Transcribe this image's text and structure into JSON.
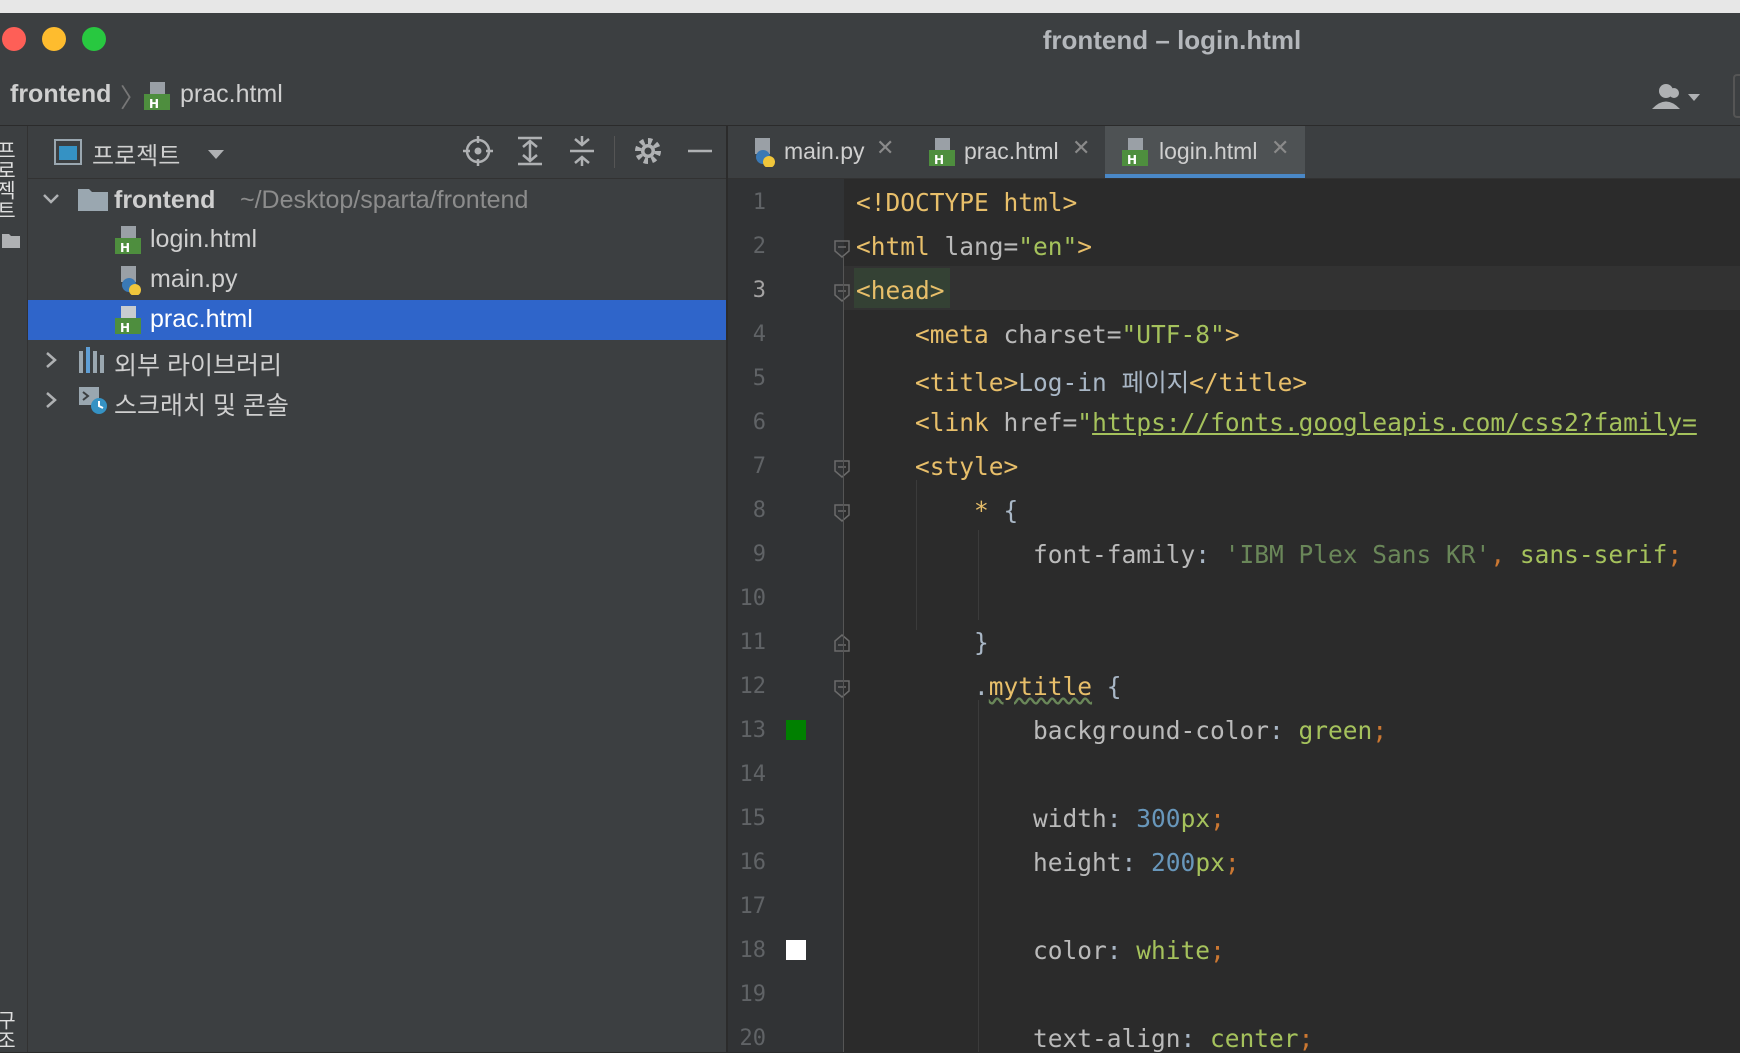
{
  "window": {
    "title": "frontend – login.html"
  },
  "breadcrumb": {
    "project": "frontend",
    "file": "prac.html"
  },
  "side_strip": {
    "top_label": "프로젝트",
    "bottom_label": "구조"
  },
  "project_panel": {
    "title": "프로젝트",
    "tree": {
      "root_name": "frontend",
      "root_path": "~/Desktop/sparta/frontend",
      "files": [
        "login.html",
        "main.py",
        "prac.html"
      ],
      "selected_file": "prac.html",
      "external_libraries": "외부 라이브러리",
      "scratches": "스크래치 및 콘솔"
    }
  },
  "tabs": [
    {
      "label": "main.py",
      "icon": "python-file-icon",
      "active": false
    },
    {
      "label": "prac.html",
      "icon": "html-file-icon",
      "active": false
    },
    {
      "label": "login.html",
      "icon": "html-file-icon",
      "active": true
    }
  ],
  "editor": {
    "current_line": 3,
    "line_numbers": [
      "1",
      "2",
      "3",
      "4",
      "5",
      "6",
      "7",
      "8",
      "9",
      "10",
      "11",
      "12",
      "13",
      "14",
      "15",
      "16",
      "17",
      "18",
      "19",
      "20"
    ],
    "lines": {
      "l1": {
        "tag": "<!DOCTYPE html>"
      },
      "l2": {
        "open": "<html",
        "attr": " lang=",
        "val": "\"en\"",
        "close": ">"
      },
      "l3": {
        "tag": "<head>"
      },
      "l4": {
        "open": "<meta",
        "attr": " charset=",
        "val": "\"UTF-8\"",
        "close": ">"
      },
      "l5": {
        "open": "<title>",
        "text": "Log-in 페이지",
        "close": "</title>"
      },
      "l6": {
        "open": "<link",
        "attr": " href=",
        "quote": "\"",
        "url": "https://fonts.googleapis.com/css2?family="
      },
      "l7": {
        "tag": "<style>"
      },
      "l8": {
        "sel": "*",
        "brace": " {"
      },
      "l9": {
        "prop": "font-family",
        "colon": ": ",
        "str": "'IBM Plex Sans KR'",
        "comma": ", ",
        "kw": "sans-serif",
        "semi": ";"
      },
      "l11": {
        "brace": "}"
      },
      "l12": {
        "dot": ".",
        "cls": "mytitle",
        "brace": " {"
      },
      "l13": {
        "prop": "background-color",
        "colon": ": ",
        "kw": "green",
        "semi": ";"
      },
      "l15": {
        "prop": "width",
        "colon": ": ",
        "num": "300",
        "unit": "px",
        "semi": ";"
      },
      "l16": {
        "prop": "height",
        "colon": ": ",
        "num": "200",
        "unit": "px",
        "semi": ";"
      },
      "l18": {
        "prop": "color",
        "colon": ": ",
        "kw": "white",
        "semi": ";"
      },
      "l20": {
        "prop": "text-align",
        "colon": ": ",
        "kw": "center",
        "semi": ";"
      }
    },
    "swatches": {
      "line13": "#008000",
      "line18": "#ffffff"
    }
  },
  "colors": {
    "selection": "#2f65ca",
    "traffic_close": "#fe5f57",
    "traffic_min": "#febc2e",
    "traffic_max": "#28c840"
  }
}
